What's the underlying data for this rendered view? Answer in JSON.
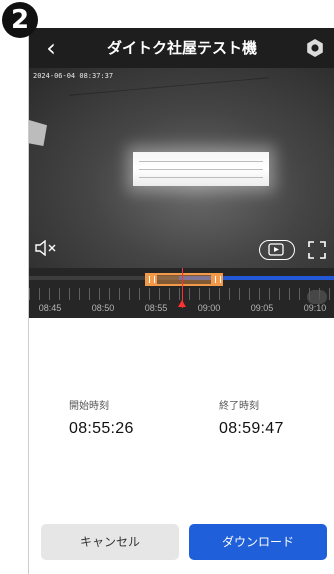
{
  "step_badge": "2",
  "header": {
    "title": "ダイトク社屋テスト機",
    "back_icon": "chevron-left-icon",
    "settings_icon": "gear-icon"
  },
  "video": {
    "timestamp": "2024-06-04 08:37:37",
    "mute_icon": "speaker-mute-icon",
    "playback_icon": "playback-icon",
    "fullscreen_icon": "fullscreen-icon"
  },
  "timeline": {
    "labels": [
      "08:45",
      "08:50",
      "08:55",
      "09:00",
      "09:05",
      "09:10"
    ],
    "clip_color": "#f2994a",
    "playhead_color": "#ff3030",
    "recording_color": "#2358d6"
  },
  "clip": {
    "start_label": "開始時刻",
    "start_value": "08:55:26",
    "end_label": "終了時刻",
    "end_value": "08:59:47"
  },
  "buttons": {
    "cancel": "キャンセル",
    "download": "ダウンロード",
    "download_color": "#1f5fd9"
  }
}
